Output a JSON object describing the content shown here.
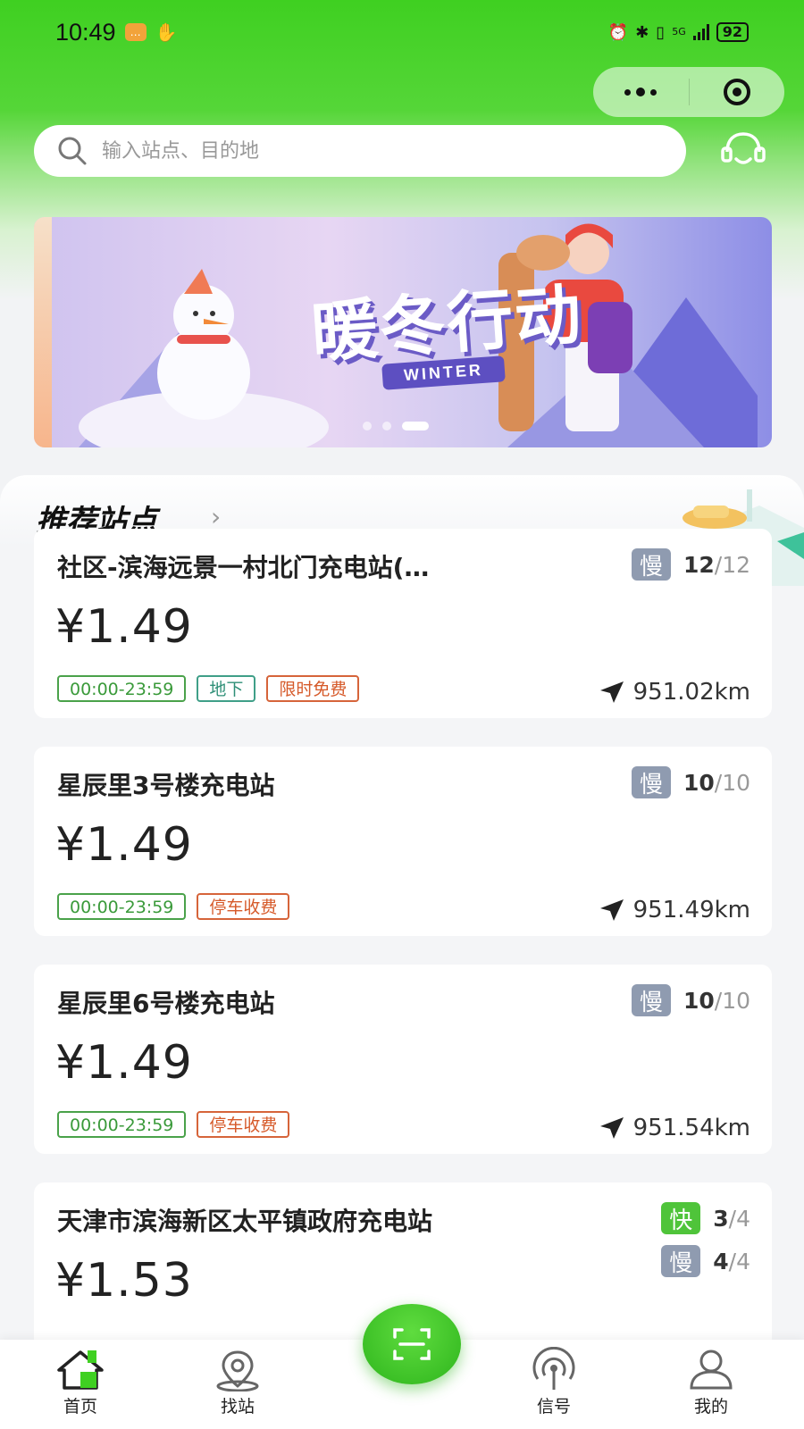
{
  "status_bar": {
    "time": "10:49",
    "battery": "92",
    "network": "5G"
  },
  "search": {
    "placeholder": "输入站点、目的地"
  },
  "banner": {
    "title": "暖冬行动",
    "subtitle": "WINTER",
    "slides_total": 3,
    "active_slide": 3
  },
  "recommend": {
    "title": "推荐站点"
  },
  "stations": [
    {
      "name": "社区-滨海远景一村北门充电站(…",
      "price": "¥1.49",
      "tags": [
        {
          "text": "00:00-23:59",
          "color": "green"
        },
        {
          "text": "地下",
          "color": "teal"
        },
        {
          "text": "限时免费",
          "color": "orange"
        }
      ],
      "slots": [
        {
          "type": "慢",
          "available": "12",
          "total": "/12"
        }
      ],
      "distance": "951.02km"
    },
    {
      "name": "星辰里3号楼充电站",
      "price": "¥1.49",
      "tags": [
        {
          "text": "00:00-23:59",
          "color": "green"
        },
        {
          "text": "停车收费",
          "color": "orange"
        }
      ],
      "slots": [
        {
          "type": "慢",
          "available": "10",
          "total": "/10"
        }
      ],
      "distance": "951.49km"
    },
    {
      "name": "星辰里6号楼充电站",
      "price": "¥1.49",
      "tags": [
        {
          "text": "00:00-23:59",
          "color": "green"
        },
        {
          "text": "停车收费",
          "color": "orange"
        }
      ],
      "slots": [
        {
          "type": "慢",
          "available": "10",
          "total": "/10"
        }
      ],
      "distance": "951.54km"
    },
    {
      "name": "天津市滨海新区太平镇政府充电站",
      "price": "¥1.53",
      "slots": [
        {
          "type": "快",
          "available": "3",
          "total": "/4"
        },
        {
          "type": "慢",
          "available": "4",
          "total": "/4"
        }
      ]
    }
  ],
  "tab_bar": {
    "home": "首页",
    "find": "找站",
    "signal": "信号",
    "mine": "我的",
    "active": "home"
  },
  "colors": {
    "brand_green": "#3fd021",
    "slow_badge": "#8f9bb0",
    "fast_badge": "#4fc43a",
    "tag_green": "#4aa24a",
    "tag_orange": "#d6643a"
  },
  "icons": [
    "search-icon",
    "customer-service-icon",
    "navigate-arrow-icon",
    "home-icon",
    "location-icon",
    "scan-icon",
    "signal-icon",
    "user-icon"
  ]
}
